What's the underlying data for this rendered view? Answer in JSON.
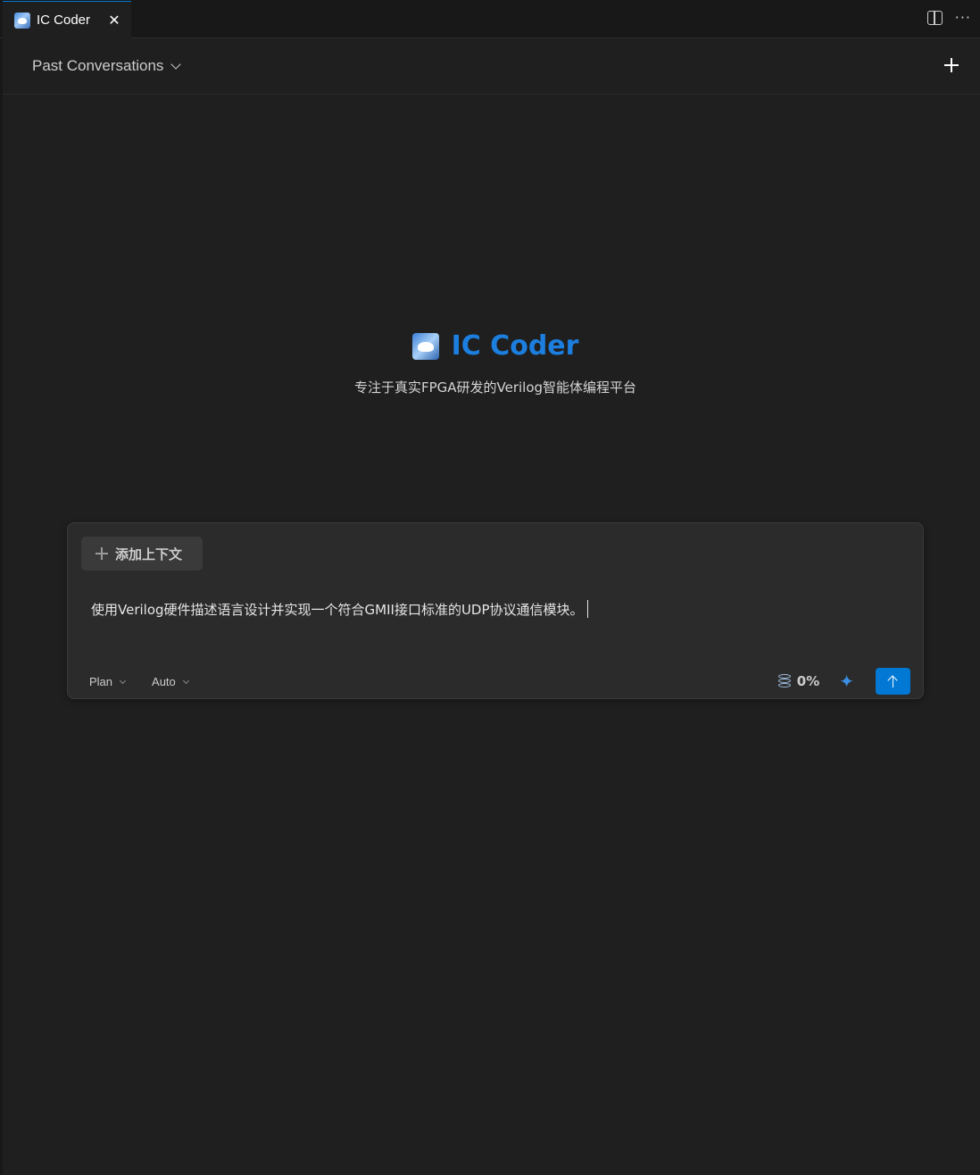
{
  "tab": {
    "title": "IC Coder",
    "close_glyph": "✕",
    "icon": "ic-coder-logo-icon"
  },
  "tabbar_actions": {
    "split_icon": "split-editor-icon",
    "more_glyph": "···"
  },
  "header": {
    "past_conversations_label": "Past Conversations",
    "new_chat_icon": "plus-icon"
  },
  "hero": {
    "title": "IC Coder",
    "subtitle": "专注于真实FPGA研发的Verilog智能体编程平台"
  },
  "composer": {
    "add_context_label": "添加上下文",
    "prompt_text": "使用Verilog硬件描述语言设计并实现一个符合GMII接口标准的UDP协议通信模块。",
    "mode_label": "Plan",
    "model_label": "Auto",
    "context_usage": "0%",
    "sparkle_glyph": "✦",
    "send_icon": "arrow-up-icon"
  },
  "colors": {
    "background": "#1f1f1f",
    "tabbar": "#181818",
    "accent": "#0078d4",
    "title_blue": "#1c7fe0",
    "card": "#2b2b2b"
  }
}
